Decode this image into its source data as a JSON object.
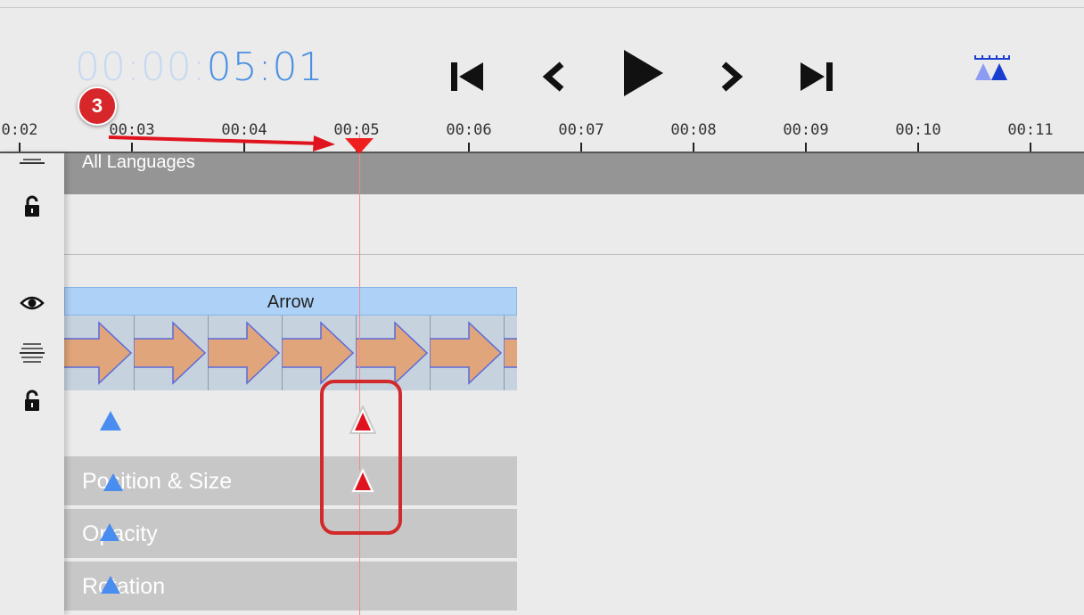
{
  "timecode": {
    "dim": "00:00:",
    "highlight": "05:01"
  },
  "transport": {
    "to_start_icon": "skip-to-start-icon",
    "step_back_icon": "step-back-icon",
    "play_icon": "play-icon",
    "step_forward_icon": "step-forward-icon",
    "to_end_icon": "skip-to-end-icon"
  },
  "zoom_icon": "timeline-zoom-icon",
  "ruler": {
    "labels": [
      "0:02",
      "00:03",
      "00:04",
      "00:05",
      "00:06",
      "00:07",
      "00:08",
      "00:09",
      "00:10",
      "00:11"
    ]
  },
  "tracks": {
    "language_track": {
      "label": "All Languages"
    },
    "clip": {
      "title": "Arrow"
    },
    "properties": [
      {
        "label": "Position & Size"
      },
      {
        "label": "Opacity"
      },
      {
        "label": "Rotation"
      }
    ]
  },
  "annotation": {
    "step_number": "3"
  },
  "colors": {
    "accent_blue": "#4a90e2",
    "keyframe_blue": "#4a8df0",
    "keyframe_red": "#e0141e",
    "callout_red": "#d22a2a",
    "arrow_fill": "#e0a57a"
  }
}
